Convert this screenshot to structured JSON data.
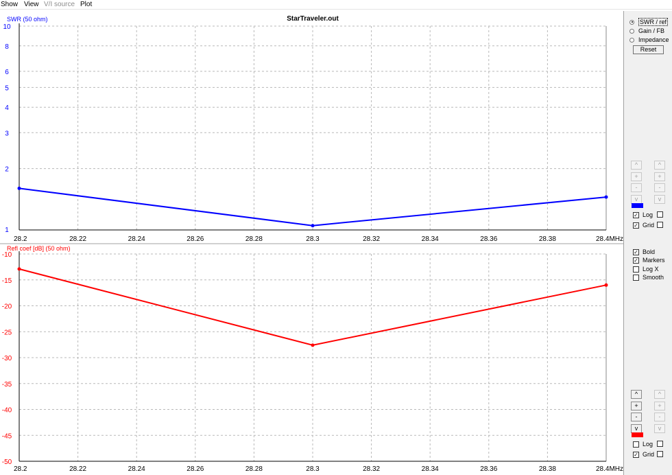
{
  "menu": [
    "Show",
    "View",
    "V/I source",
    "Plot"
  ],
  "menu_disabled": [
    false,
    false,
    true,
    false
  ],
  "panel": {
    "radios": [
      {
        "label": "SWR / ref",
        "selected": true
      },
      {
        "label": "Gain / FB",
        "selected": false
      },
      {
        "label": "Impedance",
        "selected": false
      }
    ],
    "reset_label": "Reset",
    "top_controls": {
      "buttons": [
        "^",
        "+",
        "-",
        "v"
      ],
      "active": false,
      "swatch_color": "#0000ff",
      "log_label": "Log",
      "log_checked": true,
      "grid_label": "Grid",
      "grid_checked": true
    },
    "options": [
      {
        "label": "Bold",
        "checked": true
      },
      {
        "label": "Markers",
        "checked": true
      },
      {
        "label": "Log X",
        "checked": false
      },
      {
        "label": "Smooth",
        "checked": false
      }
    ],
    "bottom_controls": {
      "buttons": [
        "^",
        "+",
        "-",
        "v"
      ],
      "active": true,
      "swatch_color": "#ff0000",
      "log_label": "Log",
      "log_checked": false,
      "grid_label": "Grid",
      "grid_checked": true
    }
  },
  "chart_data": [
    {
      "type": "line",
      "title": "StarTraveler.out",
      "ylabel": "SWR (50 ohm)",
      "color": "#0000ff",
      "y_scale": "log",
      "ylim": [
        1,
        10
      ],
      "yticks": [
        1,
        2,
        3,
        4,
        5,
        6,
        8,
        10
      ],
      "x": [
        28.2,
        28.3,
        28.4
      ],
      "values": [
        1.6,
        1.05,
        1.45
      ],
      "xlim": [
        28.2,
        28.4
      ],
      "xticks": [
        "28.2",
        "28.22",
        "28.24",
        "28.26",
        "28.28",
        "28.3",
        "28.32",
        "28.34",
        "28.36",
        "28.38",
        "28.4MHz"
      ],
      "grid": true
    },
    {
      "type": "line",
      "ylabel": "Refl coef [dB] (50 ohm)",
      "color": "#ff0000",
      "y_scale": "linear",
      "ylim": [
        -50,
        -10
      ],
      "yticks": [
        -10,
        -15,
        -20,
        -25,
        -30,
        -35,
        -40,
        -45,
        -50
      ],
      "x": [
        28.2,
        28.3,
        28.4
      ],
      "values": [
        -12.9,
        -27.6,
        -16.0
      ],
      "xlim": [
        28.2,
        28.4
      ],
      "xticks": [
        "28.2",
        "28.22",
        "28.24",
        "28.26",
        "28.28",
        "28.3",
        "28.32",
        "28.34",
        "28.36",
        "28.38",
        "28.4MHz"
      ],
      "grid": true
    }
  ]
}
